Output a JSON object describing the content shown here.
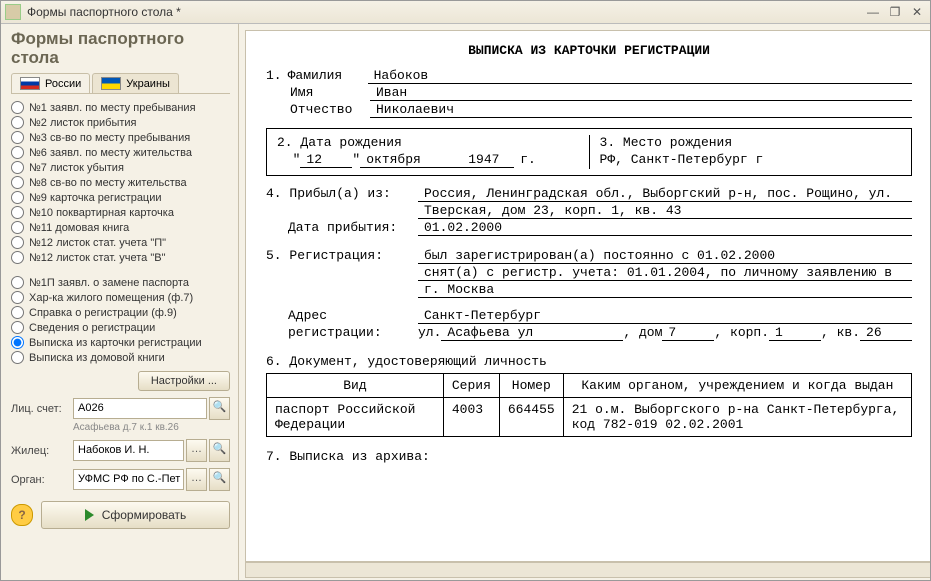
{
  "window": {
    "title": "Формы паспортного стола *"
  },
  "sidebar": {
    "heading": "Формы паспортного стола",
    "tabs": {
      "russia": "России",
      "ukraine": "Украины"
    },
    "groupA": [
      "№1  заявл. по месту пребывания",
      "№2  листок прибытия",
      "№3  св-во по месту пребывания",
      "№6  заявл. по месту жительства",
      "№7  листок убытия",
      "№8  св-во по месту жительства",
      "№9  карточка регистрации",
      "№10 поквартирная карточка",
      "№11 домовая книга",
      "№12 листок стат. учета \"П\"",
      "№12 листок стат. учета \"В\""
    ],
    "groupB": [
      "№1П  заявл. о замене паспорта",
      "Хар-ка жилого помещения (ф.7)",
      "Справка о регистрации (ф.9)",
      "Сведения о регистрации",
      "Выписка из карточки регистрации",
      "Выписка из домовой книги"
    ],
    "selectedB": 4,
    "settings_btn": "Настройки ...",
    "fields": {
      "account_lbl": "Лиц. счет:",
      "account_val": "A026",
      "account_hint": "Асафьева д.7 к.1 кв.26",
      "tenant_lbl": "Жилец:",
      "tenant_val": "Набоков И. Н.",
      "organ_lbl": "Орган:",
      "organ_val": "УФМС РФ по С.-Пет"
    },
    "run_btn": "Сформировать"
  },
  "doc": {
    "title": "ВЫПИСКА ИЗ КАРТОЧКИ РЕГИСТРАЦИИ",
    "s1": {
      "num": "1.",
      "fam_l": "Фамилия",
      "fam_v": "Набоков",
      "name_l": "Имя",
      "name_v": "Иван",
      "pat_l": "Отчество",
      "pat_v": "Николаевич"
    },
    "s2": {
      "dob_l": "2. Дата рождения",
      "dob_d": "12",
      "dob_m": "октября",
      "dob_y": "1947",
      "dob_suffix": "г.",
      "pob_l": "3. Место рождения",
      "pob_v": "РФ, Санкт-Петербург г"
    },
    "s4": {
      "l": "4. Прибыл(а) из:",
      "v1": "Россия, Ленинградская обл., Выборгский р-н, пос. Рощино, ул.",
      "v2": "Тверская, дом 23, корп. 1, кв. 43",
      "date_l": "Дата прибытия:",
      "date_v": "01.02.2000"
    },
    "s5": {
      "l": "5. Регистрация:",
      "v1": "был зарегистрирован(а) постоянно с 01.02.2000",
      "v2": "снят(а) с регистр. учета: 01.01.2004, по личному заявлению в",
      "v3": "г. Москва",
      "addr_l1": "Адрес",
      "addr_l2": "регистрации:",
      "city": "Санкт-Петербург",
      "street_pre": "ул.",
      "street": "Асафьева ул",
      "dom_l": ", дом",
      "dom": "7",
      "korp_l": ", корп.",
      "korp": "1",
      "kv_l": ", кв.",
      "kv": "26"
    },
    "s6": {
      "l": "6. Документ, удостоверяющий личность",
      "th": [
        "Вид",
        "Серия",
        "Номер",
        "Каким органом, учреждением и когда выдан"
      ],
      "td": [
        "паспорт Российской Федерации",
        "4003",
        "664455",
        "21 о.м. Выборгского р-на Санкт-Петербурга, код 782-019 02.02.2001"
      ]
    },
    "s7": {
      "l": "7. Выписка из архива:"
    }
  }
}
